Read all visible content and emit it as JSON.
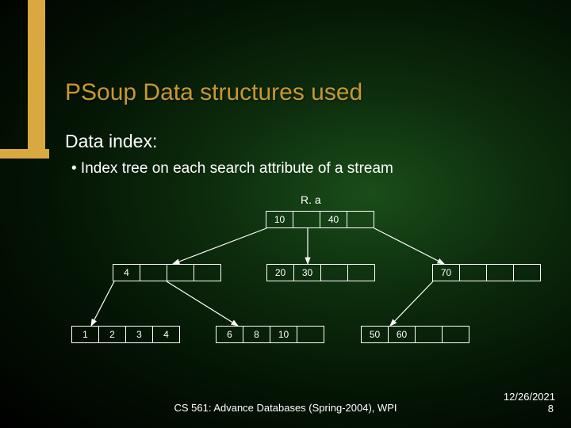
{
  "title": "PSoup Data structures used",
  "subtitle": "Data index:",
  "bullet": "• Index tree on each search attribute of a stream",
  "root_label": "R. a",
  "nodes": {
    "root": [
      "10",
      "",
      "40",
      ""
    ],
    "mid_left": [
      "4",
      "",
      "",
      ""
    ],
    "mid_mid": [
      "20",
      "30",
      "",
      ""
    ],
    "mid_right": [
      "70",
      "",
      "",
      ""
    ],
    "leaf1": [
      "1",
      "2",
      "3",
      "4"
    ],
    "leaf2": [
      "6",
      "8",
      "10",
      ""
    ],
    "leaf3": [
      "50",
      "60",
      "",
      ""
    ]
  },
  "footer": {
    "center": "CS 561: Advance Databases (Spring-2004), WPI",
    "date": "12/26/2021",
    "page": "8"
  }
}
